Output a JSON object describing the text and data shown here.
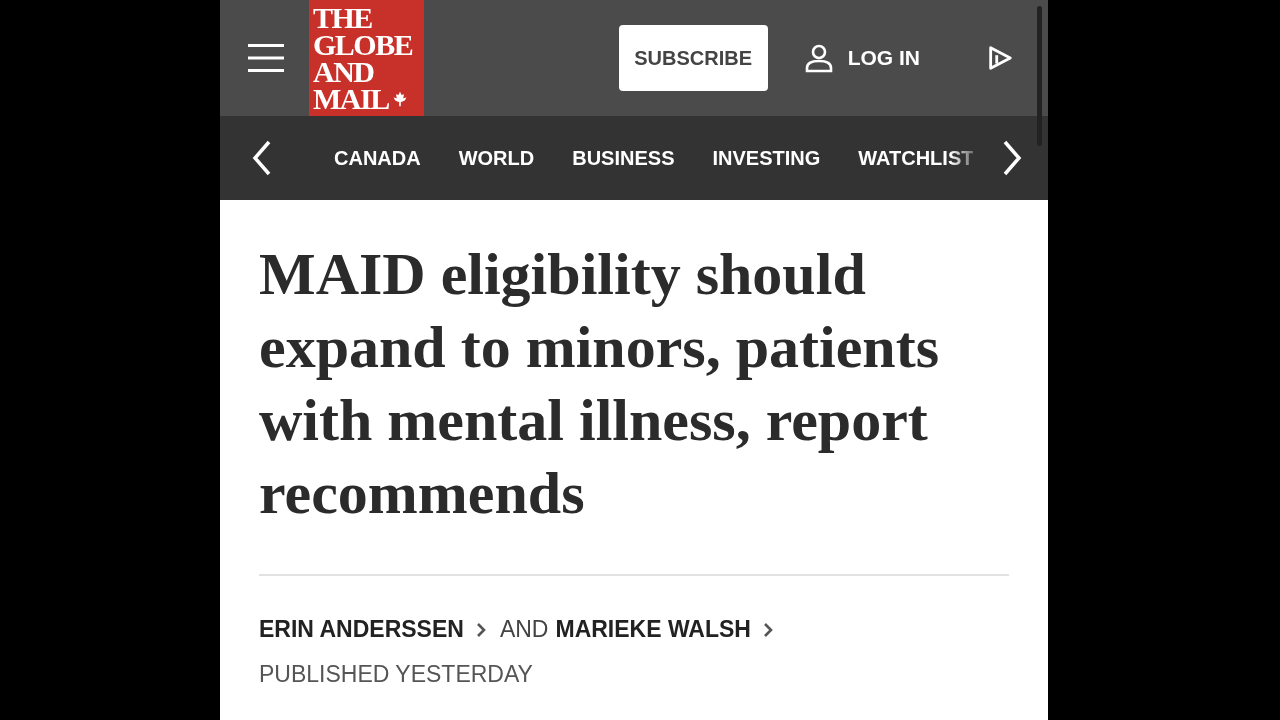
{
  "header": {
    "logo_lines": [
      "THE",
      "GLOBE",
      "AND",
      "MAIL"
    ],
    "subscribe": "SUBSCRIBE",
    "login": "LOG IN"
  },
  "nav": {
    "items": [
      {
        "label": "CANADA",
        "faded": false
      },
      {
        "label": "WORLD",
        "faded": false
      },
      {
        "label": "BUSINESS",
        "faded": false
      },
      {
        "label": "INVESTING",
        "faded": false
      },
      {
        "label": "WATCHLIST",
        "faded": true
      }
    ]
  },
  "article": {
    "headline": "MAID eligibility should expand to minors, patients with mental illness, report recommends",
    "authors": [
      "ERIN ANDERSSEN",
      "MARIEKE WALSH"
    ],
    "author_joiner": "AND",
    "published": "PUBLISHED YESTERDAY"
  }
}
